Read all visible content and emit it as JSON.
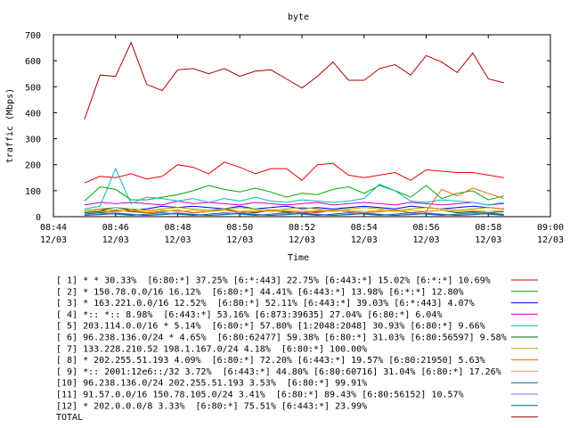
{
  "chart_data": {
    "type": "line",
    "title": "byte",
    "xlabel": "Time",
    "ylabel": "traffic (Mbps)",
    "ylim": [
      0,
      700
    ],
    "yticks": [
      "0",
      "100",
      "200",
      "300",
      "400",
      "500",
      "600",
      "700"
    ],
    "xlim": [
      "08:44",
      "09:00"
    ],
    "xticks": [
      {
        "time": "08:44",
        "date": "12/03"
      },
      {
        "time": "08:46",
        "date": "12/03"
      },
      {
        "time": "08:48",
        "date": "12/03"
      },
      {
        "time": "08:50",
        "date": "12/03"
      },
      {
        "time": "08:52",
        "date": "12/03"
      },
      {
        "time": "08:54",
        "date": "12/03"
      },
      {
        "time": "08:56",
        "date": "12/03"
      },
      {
        "time": "08:58",
        "date": "12/03"
      },
      {
        "time": "09:00",
        "date": "12/03"
      }
    ],
    "grid": false,
    "legend_position": "bottom",
    "x": [
      "08:45:00",
      "08:45:30",
      "08:46:00",
      "08:46:30",
      "08:47:00",
      "08:47:30",
      "08:48:00",
      "08:48:30",
      "08:49:00",
      "08:49:30",
      "08:50:00",
      "08:50:30",
      "08:51:00",
      "08:51:30",
      "08:52:00",
      "08:52:30",
      "08:53:00",
      "08:53:30",
      "08:54:00",
      "08:54:30",
      "08:55:00",
      "08:55:30",
      "08:56:00",
      "08:56:30",
      "08:57:00",
      "08:57:30",
      "08:58:00",
      "08:58:30"
    ],
    "series": [
      {
        "name": "[ 1] * * 30.33%  [6:80:*] 37.25% [6:*:443] 22.75% [6:443:*] 15.02% [6:*:*] 10.69%",
        "color": "#ee0000",
        "values": [
          130,
          155,
          150,
          165,
          145,
          155,
          200,
          190,
          165,
          210,
          190,
          165,
          185,
          185,
          140,
          200,
          205,
          160,
          150,
          160,
          170,
          140,
          180,
          175,
          170,
          170,
          160,
          150
        ]
      },
      {
        "name": "[ 2] * 150.78.0.0/16 16.12%  [6:80:*] 44.41% [6:443:*] 13.98% [6:*:*] 12.80%",
        "color": "#00aa00",
        "values": [
          60,
          115,
          105,
          65,
          65,
          75,
          85,
          100,
          120,
          105,
          95,
          110,
          95,
          75,
          90,
          85,
          105,
          115,
          90,
          120,
          100,
          75,
          120,
          70,
          90,
          100,
          65,
          80
        ]
      },
      {
        "name": "[ 3] * 163.221.0.0/16 12.52%  [6:80:*] 52.11% [6:443:*] 39.03% [6:*:443] 4.07%",
        "color": "#0000ee",
        "values": [
          20,
          25,
          35,
          25,
          30,
          40,
          35,
          40,
          35,
          30,
          40,
          30,
          35,
          40,
          30,
          35,
          30,
          35,
          40,
          35,
          30,
          40,
          35,
          30,
          35,
          40,
          35,
          30
        ]
      },
      {
        "name": "[ 4] *:: *:: 8.98%  [6:443:*] 53.16% [6:873:39635] 27.04% [6:80:*] 6.04%",
        "color": "#cc00cc",
        "values": [
          45,
          55,
          50,
          55,
          50,
          45,
          60,
          50,
          55,
          50,
          45,
          55,
          50,
          45,
          50,
          55,
          45,
          50,
          55,
          50,
          45,
          55,
          50,
          45,
          50,
          55,
          45,
          50
        ]
      },
      {
        "name": "[ 5] 203.114.0.0/16 * 5.14%  [6:80:*] 57.80% [1:2048:2048] 30.93% [6:80:*] 9.66%",
        "color": "#00bbbb",
        "values": [
          30,
          40,
          185,
          50,
          75,
          70,
          60,
          70,
          55,
          70,
          60,
          75,
          60,
          55,
          65,
          60,
          55,
          60,
          70,
          125,
          100,
          60,
          55,
          65,
          60,
          55,
          45,
          55
        ]
      },
      {
        "name": "[ 6] 96.238.136.0/24 * 4.65%  [6:80:62477] 59.38% [6:80:*] 31.03% [6:80:56597] 9.58%",
        "color": "#006600",
        "values": [
          15,
          20,
          25,
          20,
          15,
          20,
          25,
          15,
          20,
          30,
          20,
          15,
          25,
          20,
          15,
          20,
          25,
          20,
          15,
          20,
          25,
          15,
          20,
          25,
          15,
          20,
          15,
          20
        ]
      },
      {
        "name": "[ 7] 133.228.210.52 198.1.167.0/24 4.18%  [6:80:*] 100.00%",
        "color": "#aaaa00",
        "values": [
          25,
          30,
          35,
          30,
          25,
          30,
          35,
          30,
          25,
          30,
          35,
          30,
          25,
          30,
          35,
          30,
          25,
          30,
          35,
          30,
          25,
          30,
          35,
          30,
          25,
          30,
          35,
          30
        ]
      },
      {
        "name": "[ 8] * 202.255.51.193 4.09%  [6:80:*] 72.20% [6:443:*] 19.57% [6:80:21950] 5.63%",
        "color": "#ee6600",
        "values": [
          10,
          15,
          20,
          25,
          15,
          20,
          25,
          15,
          20,
          25,
          15,
          20,
          25,
          15,
          20,
          15,
          25,
          20,
          15,
          20,
          25,
          15,
          20,
          105,
          80,
          110,
          90,
          70
        ]
      },
      {
        "name": "[ 9] *:: 2001:12e6::/32 3.72%  [6:443:*] 44.80% [6:80:60716] 31.04% [6:80:*] 17.26%",
        "color": "#eeaa00",
        "values": [
          20,
          25,
          20,
          25,
          20,
          25,
          20,
          25,
          20,
          25,
          20,
          25,
          20,
          25,
          20,
          25,
          20,
          25,
          20,
          25,
          20,
          25,
          20,
          25,
          20,
          25,
          20,
          25
        ]
      },
      {
        "name": "[10] 96.238.136.0/24 202.255.51.193 3.53%  [6:80:*] 99.91%",
        "color": "#0066aa",
        "values": [
          10,
          15,
          10,
          5,
          10,
          15,
          10,
          5,
          10,
          15,
          10,
          5,
          10,
          15,
          10,
          5,
          10,
          15,
          10,
          5,
          10,
          15,
          10,
          5,
          10,
          15,
          10,
          5
        ]
      },
      {
        "name": "[11] 91.57.0.0/16 150.78.105.0/24 3.41%  [6:80:*] 89.43% [6:80:56152] 10.57%",
        "color": "#aa66ee",
        "values": [
          5,
          10,
          15,
          10,
          5,
          10,
          15,
          10,
          5,
          10,
          15,
          10,
          5,
          10,
          15,
          10,
          5,
          10,
          15,
          10,
          5,
          10,
          15,
          10,
          5,
          10,
          15,
          10
        ]
      },
      {
        "name": "[12] * 202.0.0.0/8 3.33%  [6:80:*] 75.51% [6:443:*] 23.99%",
        "color": "#006699",
        "values": [
          5,
          8,
          12,
          8,
          5,
          8,
          12,
          8,
          5,
          8,
          12,
          8,
          5,
          8,
          12,
          8,
          5,
          8,
          12,
          8,
          5,
          8,
          12,
          8,
          5,
          8,
          12,
          8
        ]
      },
      {
        "name": "TOTAL",
        "color": "#aa0000",
        "values": [
          375,
          545,
          540,
          670,
          510,
          485,
          565,
          570,
          550,
          570,
          540,
          560,
          565,
          530,
          495,
          540,
          595,
          525,
          525,
          570,
          585,
          545,
          620,
          595,
          555,
          630,
          530,
          515
        ]
      }
    ]
  }
}
